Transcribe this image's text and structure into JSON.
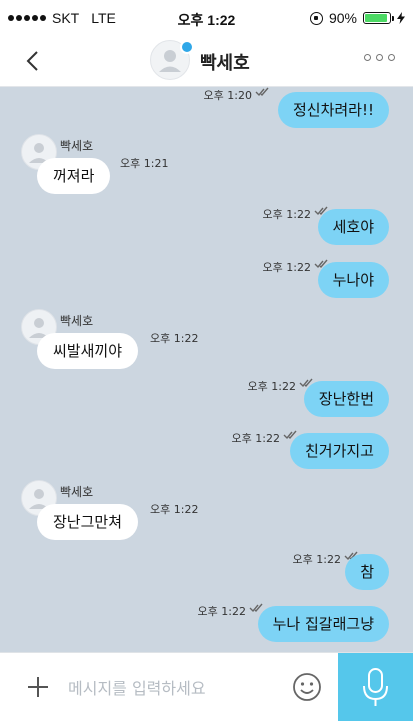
{
  "status_bar": {
    "carrier": "SKT",
    "network": "LTE",
    "time": "오후 1:22",
    "battery": "90%",
    "battery_level": 0.9
  },
  "header": {
    "contact_name": "빡세호"
  },
  "messages": {
    "m1": {
      "text": "정신차려라!!",
      "time": "오후 1:20"
    },
    "m2": {
      "sender": "빡세호",
      "text": "꺼져라",
      "time": "오후 1:21"
    },
    "m3": {
      "text": "세호야",
      "time": "오후 1:22"
    },
    "m4": {
      "text": "누나야",
      "time": "오후 1:22"
    },
    "m5": {
      "sender": "빡세호",
      "text": "씨발새끼야",
      "time": "오후 1:22"
    },
    "m6": {
      "text": "장난한번",
      "time": "오후 1:22"
    },
    "m7": {
      "text": "친거가지고",
      "time": "오후 1:22"
    },
    "m8": {
      "sender": "빡세호",
      "text": "장난그만쳐",
      "time": "오후 1:22"
    },
    "m9": {
      "text": "참",
      "time": "오후 1:22"
    },
    "m10": {
      "text": "누나 집갈래그냥",
      "time": "오후 1:22"
    }
  },
  "input": {
    "placeholder": "메시지를 입력하세요",
    "value": ""
  },
  "colors": {
    "chat_background": "#ccd6e0",
    "outgoing_bubble": "#7dd3f5",
    "incoming_bubble": "#ffffff",
    "accent": "#55c7eb"
  },
  "icons": {
    "back": "chevron-left-icon",
    "more": "more-dots-icon",
    "plus": "plus-icon",
    "emoji": "smiley-icon",
    "mic": "microphone-icon",
    "read": "double-check-icon"
  }
}
